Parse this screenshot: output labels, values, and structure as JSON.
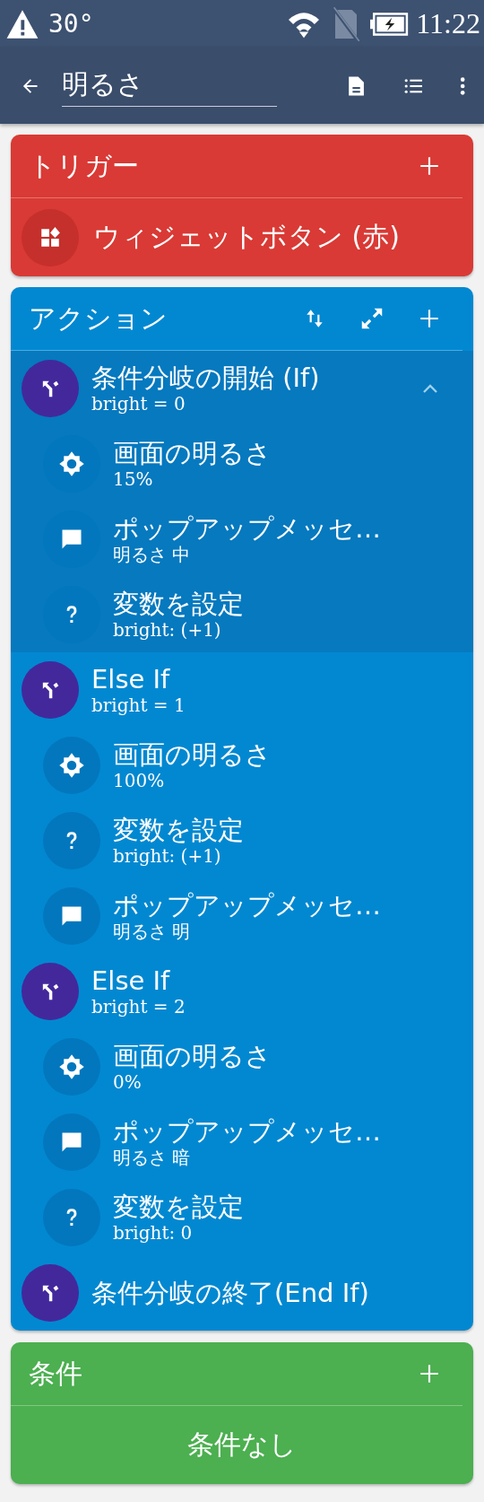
{
  "status_bar": {
    "temperature": "30°",
    "time": "11:22"
  },
  "app_bar": {
    "title_field": {
      "value": "明るさ"
    }
  },
  "trigger": {
    "title": "トリガー",
    "items": [
      {
        "label": "ウィジェットボタン (赤)"
      }
    ]
  },
  "actions": {
    "title": "アクション",
    "items": [
      {
        "title": "条件分岐の開始 (If)",
        "subtitle": "bright = 0",
        "expanded": true,
        "selected": true,
        "children": [
          {
            "kind": "brightness",
            "title": "画面の明るさ",
            "subtitle": "15%"
          },
          {
            "kind": "popup",
            "title": "ポップアップメッセ…",
            "subtitle": "明るさ 中"
          },
          {
            "kind": "variable",
            "title": "変数を設定",
            "subtitle": "bright: (+1)"
          }
        ]
      },
      {
        "title": "Else If",
        "subtitle": "bright = 1",
        "selected": false,
        "children": [
          {
            "kind": "brightness",
            "title": "画面の明るさ",
            "subtitle": "100%"
          },
          {
            "kind": "variable",
            "title": "変数を設定",
            "subtitle": "bright: (+1)"
          },
          {
            "kind": "popup",
            "title": "ポップアップメッセ…",
            "subtitle": "明るさ 明"
          }
        ]
      },
      {
        "title": "Else If",
        "subtitle": "bright = 2",
        "selected": false,
        "children": [
          {
            "kind": "brightness",
            "title": "画面の明るさ",
            "subtitle": "0%"
          },
          {
            "kind": "popup",
            "title": "ポップアップメッセ…",
            "subtitle": "明るさ 暗"
          },
          {
            "kind": "variable",
            "title": "変数を設定",
            "subtitle": "bright: 0"
          }
        ]
      },
      {
        "title": "条件分岐の終了(End If)",
        "selected": false
      }
    ]
  },
  "conditions": {
    "title": "条件",
    "empty_text": "条件なし"
  }
}
